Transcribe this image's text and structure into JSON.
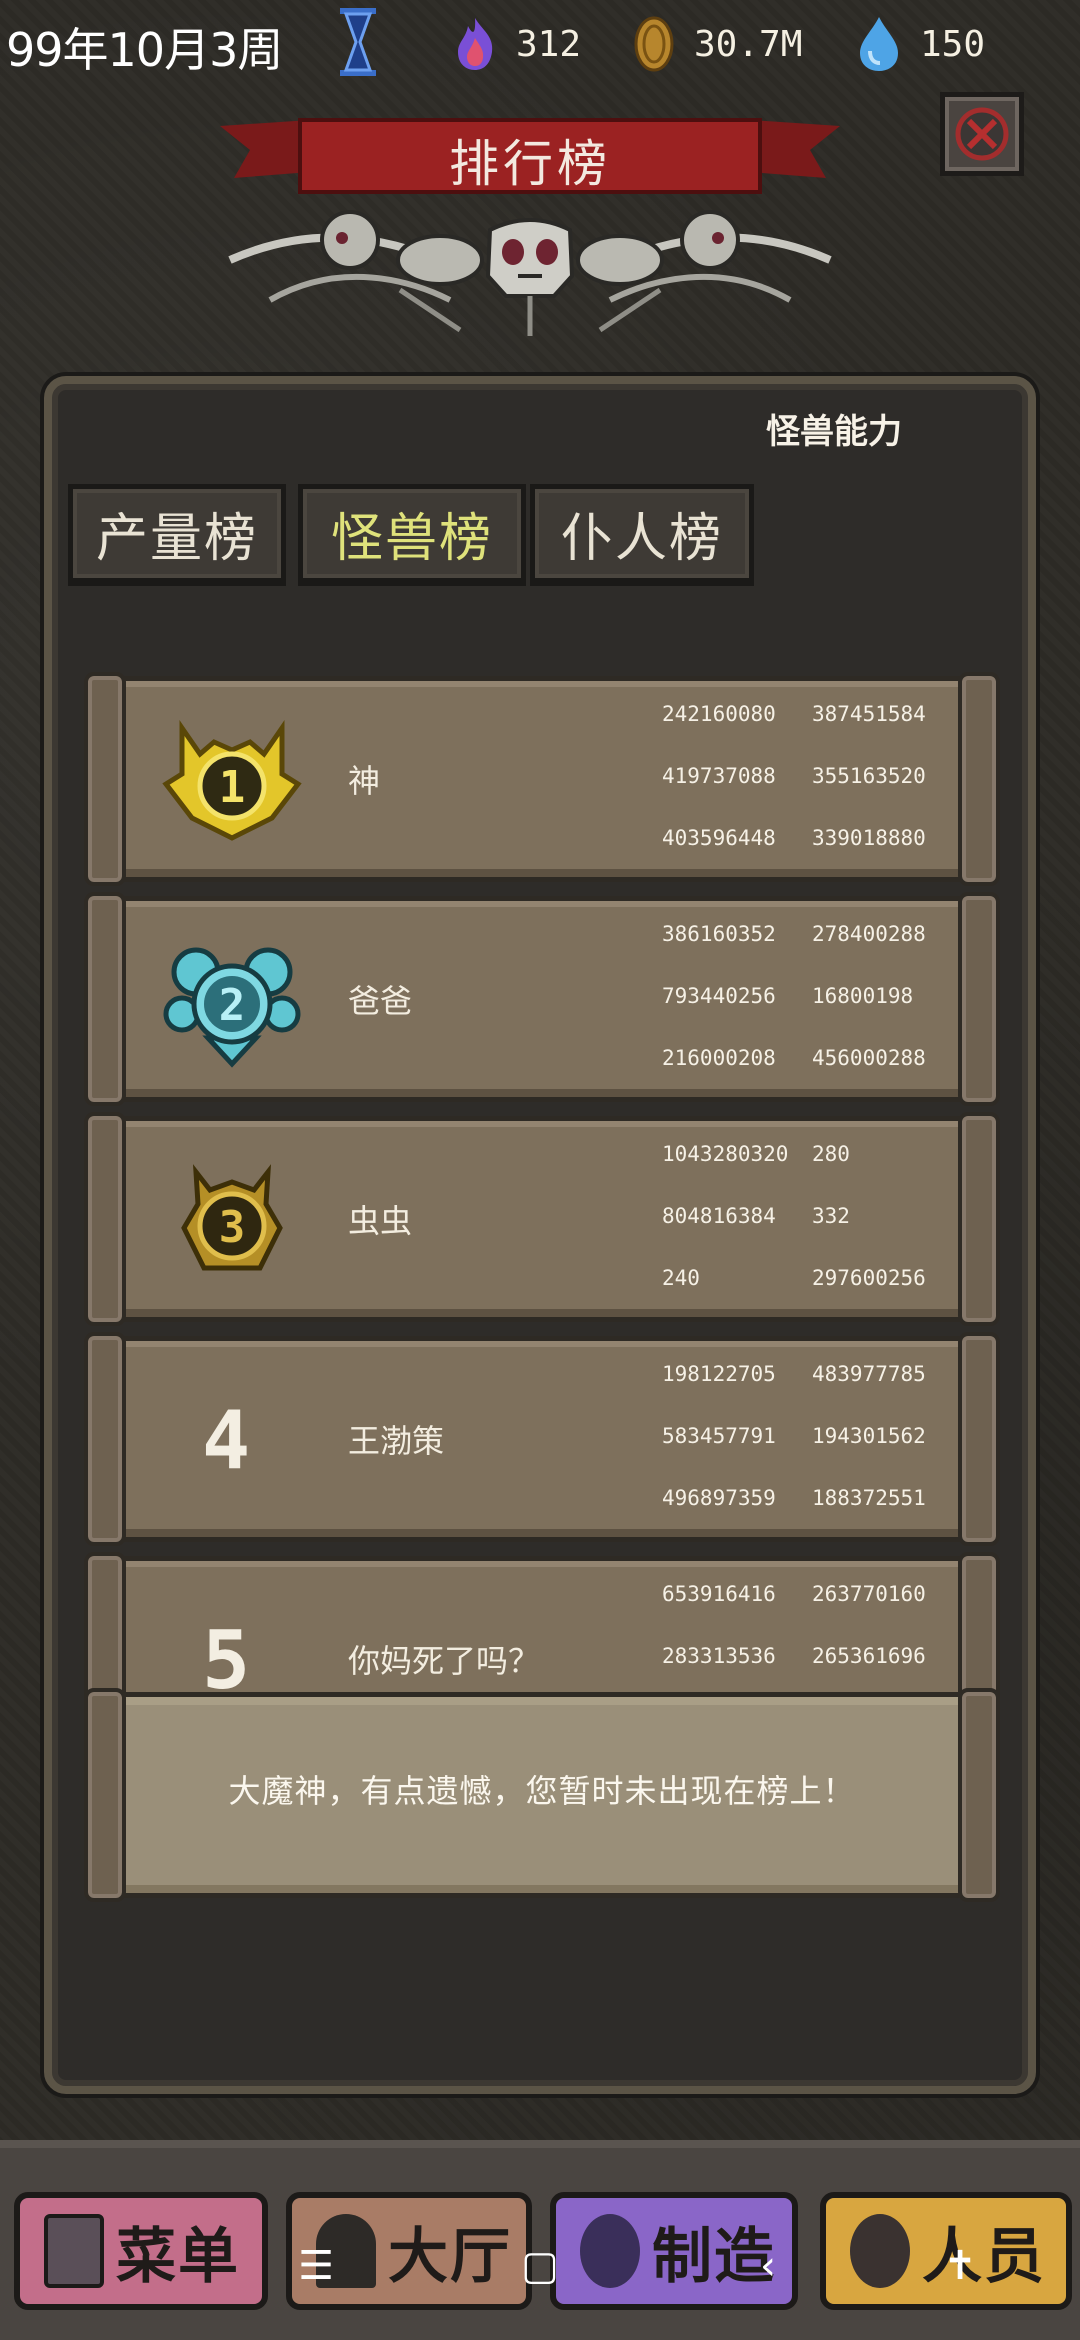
{
  "status": {
    "date": "99年10月3周",
    "fire": "312",
    "gold": "30.7M",
    "water": "150"
  },
  "title": "排行榜",
  "subtitle": "怪兽能力",
  "tabs": [
    {
      "label": "产量榜"
    },
    {
      "label": "怪兽榜"
    },
    {
      "label": "仆人榜"
    }
  ],
  "rows": [
    {
      "rank": "1",
      "name": "神",
      "values": [
        "242160080",
        "387451584",
        "419737088",
        "355163520",
        "403596448",
        "339018880"
      ]
    },
    {
      "rank": "2",
      "name": "爸爸",
      "values": [
        "386160352",
        "278400288",
        "793440256",
        "16800198",
        "216000208",
        "456000288"
      ]
    },
    {
      "rank": "3",
      "name": "虫虫",
      "values": [
        "1043280320",
        "280",
        "804816384",
        "332",
        "240",
        "297600256"
      ]
    },
    {
      "rank": "4",
      "name": "王渤策",
      "values": [
        "198122705",
        "483977785",
        "583457791",
        "194301562",
        "496897359",
        "188372551"
      ]
    },
    {
      "rank": "5",
      "name": "你妈死了吗？",
      "values": [
        "653916416",
        "263770160",
        "283313536",
        "265361696"
      ]
    }
  ],
  "message": "大魔神，有点遗憾，您暂时未出现在榜上！",
  "bottom_menu": [
    {
      "label": "菜单"
    },
    {
      "label": "大厅"
    },
    {
      "label": "制造"
    },
    {
      "label": "人员"
    }
  ],
  "colors": {
    "active_tab": "#dfe27b",
    "banner_red": "#9b2222",
    "gold_medal": "#e3c62a",
    "silver_medal": "#5fc6d2",
    "bronze_medal": "#b58f26"
  }
}
